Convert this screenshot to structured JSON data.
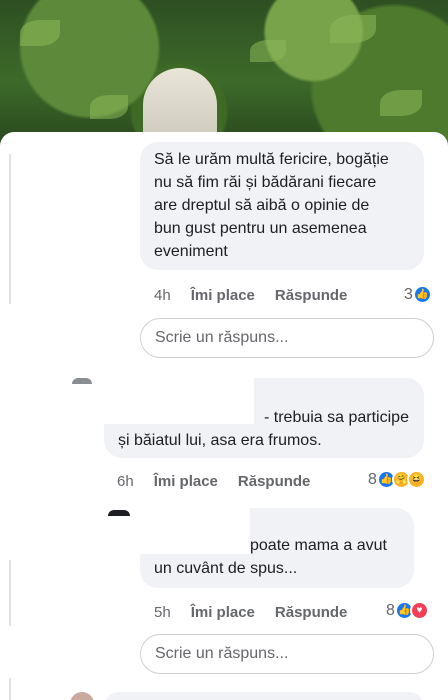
{
  "comments": [
    {
      "text_lines": [
        "Să le urăm multă fericire, bogăție",
        "nu să fim răi și bădărani fiecare",
        "are dreptul să aibă o opinie de",
        "bun gust pentru un asemenea",
        "eveniment"
      ],
      "time": "4h",
      "like_label": "Îmi place",
      "reply_label": "Răspunde",
      "reaction_count": "3",
      "reactions": [
        "like-icon"
      ]
    },
    {
      "text_lines": [
        "- trebuia sa participe",
        "și băiatul lui, asa era frumos."
      ],
      "time": "6h",
      "like_label": "Îmi place",
      "reply_label": "Răspunde",
      "reaction_count": "8",
      "reactions": [
        "like-icon",
        "care-icon",
        "haha-icon"
      ]
    },
    {
      "text_lines": [
        "poate mama a avut",
        "un cuvânt de spus..."
      ],
      "time": "5h",
      "like_label": "Îmi place",
      "reply_label": "Răspunde",
      "reaction_count": "8",
      "reactions": [
        "like-icon",
        "love-icon"
      ]
    }
  ],
  "reply_boxes": [
    {
      "placeholder": "Scrie un răspuns..."
    },
    {
      "placeholder": "Scrie un răspuns..."
    }
  ],
  "colors": {
    "like": "#1877f2",
    "love": "#f33e58",
    "haha": "#f7b125",
    "bubble": "#f0f2f5",
    "meta": "#65676b"
  }
}
